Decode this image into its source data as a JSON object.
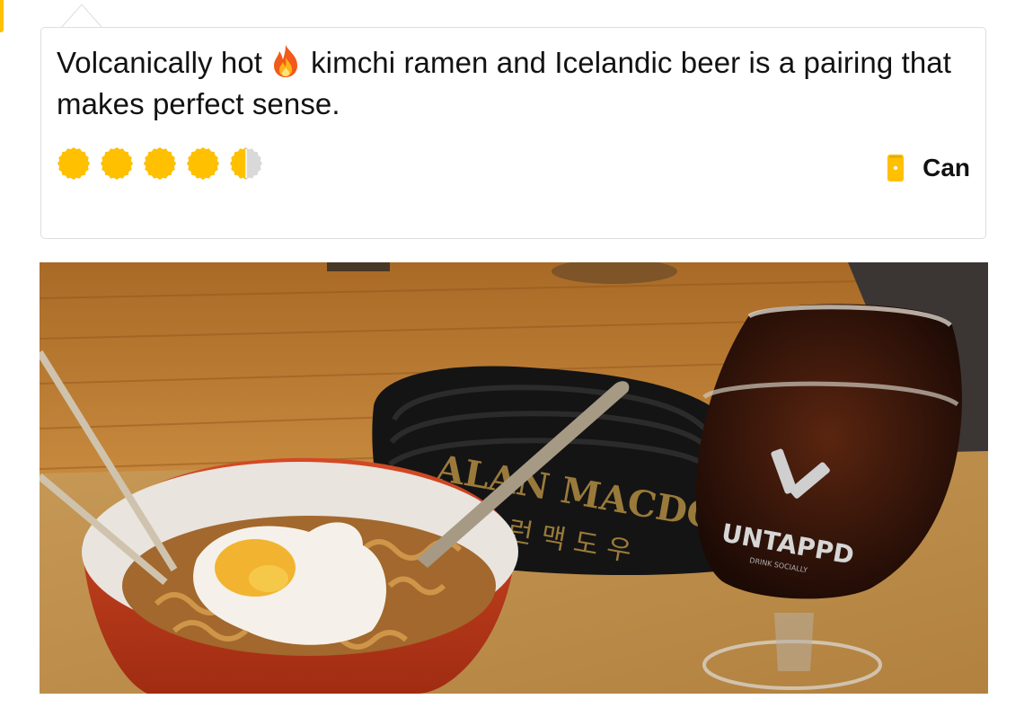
{
  "checkin": {
    "comment_part1": "Volcanically hot",
    "comment_emoji": "fire-emoji",
    "comment_part2": "kimchi ramen and Icelandic beer is a pairing that makes perfect sense.",
    "rating": 4.5,
    "rating_max": 5,
    "serving_style": "Can",
    "accent_color": "#ffc000"
  },
  "photo": {
    "belt_text": "ALAN MACDO",
    "belt_text_korean": "런 맥 도 우",
    "glass_logo": "UNTAPPD",
    "glass_sub": "DRINK SOCIALLY"
  }
}
